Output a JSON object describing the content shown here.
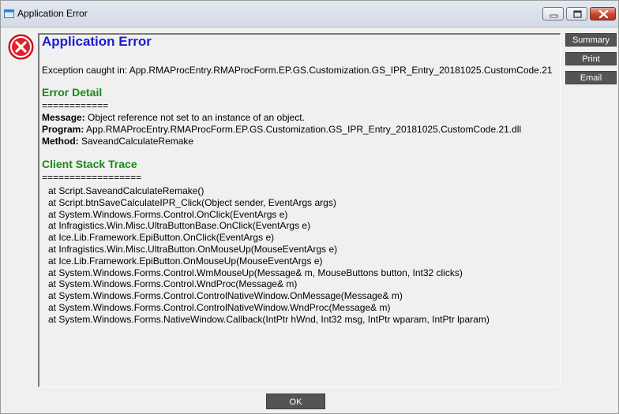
{
  "window": {
    "title": "Application Error"
  },
  "content": {
    "heading": "Application Error",
    "exception_prefix": "Exception caught in:",
    "exception_source": "App.RMAProcEntry.RMAProcForm.EP.GS.Customization.GS_IPR_Entry_20181025.CustomCode.21",
    "error_detail": {
      "heading": "Error Detail",
      "separator": "============",
      "message_label": "Message:",
      "message_value": "Object reference not set to an instance of an object.",
      "program_label": "Program:",
      "program_value": "App.RMAProcEntry.RMAProcForm.EP.GS.Customization.GS_IPR_Entry_20181025.CustomCode.21.dll",
      "method_label": "Method:",
      "method_value": "SaveandCalculateRemake"
    },
    "stack_trace": {
      "heading": "Client Stack Trace",
      "separator": "==================",
      "lines": [
        "at Script.SaveandCalculateRemake()",
        "at Script.btnSaveCalculateIPR_Click(Object sender, EventArgs args)",
        "at System.Windows.Forms.Control.OnClick(EventArgs e)",
        "at Infragistics.Win.Misc.UltraButtonBase.OnClick(EventArgs e)",
        "at Ice.Lib.Framework.EpiButton.OnClick(EventArgs e)",
        "at Infragistics.Win.Misc.UltraButton.OnMouseUp(MouseEventArgs e)",
        "at Ice.Lib.Framework.EpiButton.OnMouseUp(MouseEventArgs e)",
        "at System.Windows.Forms.Control.WmMouseUp(Message& m, MouseButtons button, Int32 clicks)",
        "at System.Windows.Forms.Control.WndProc(Message& m)",
        "at System.Windows.Forms.Control.ControlNativeWindow.OnMessage(Message& m)",
        "at System.Windows.Forms.Control.ControlNativeWindow.WndProc(Message& m)",
        "at System.Windows.Forms.NativeWindow.Callback(IntPtr hWnd, Int32 msg, IntPtr wparam, IntPtr lparam)"
      ]
    }
  },
  "buttons": {
    "summary": "Summary",
    "print": "Print",
    "email": "Email",
    "ok": "OK"
  },
  "icons": {
    "app": "app-window-icon",
    "error": "error-x-icon",
    "minimize": "minimize-icon",
    "maximize": "maximize-icon",
    "close": "close-icon"
  },
  "colors": {
    "heading_blue": "#1c1cd2",
    "section_green": "#178a17",
    "button_dark": "#545454",
    "error_red": "#e0202a"
  }
}
